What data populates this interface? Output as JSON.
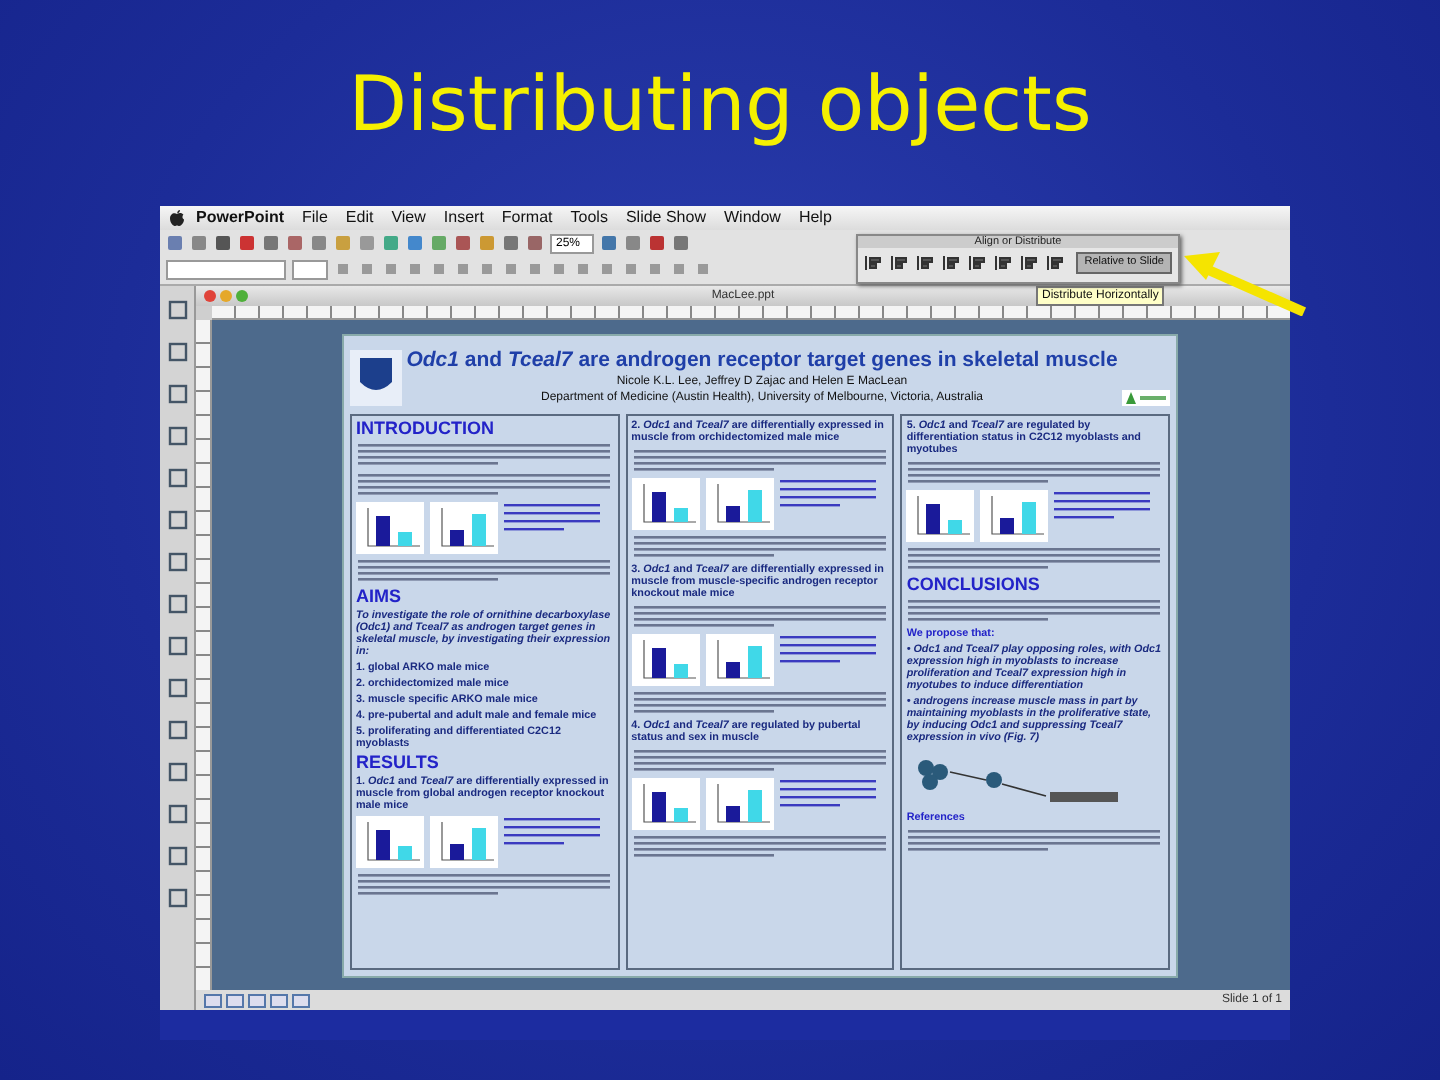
{
  "slide_title": "Distributing objects",
  "menu_bar": {
    "items": [
      "PowerPoint",
      "File",
      "Edit",
      "View",
      "Insert",
      "Format",
      "Tools",
      "Slide Show",
      "Window",
      "Help"
    ]
  },
  "toolbar": {
    "zoom": "25%"
  },
  "align_palette": {
    "title": "Align or Distribute",
    "button": "Relative to Slide",
    "tooltip": "Distribute Horizontally"
  },
  "document": {
    "title": "MacLee.ppt",
    "status": "Slide 1 of 1"
  },
  "poster": {
    "title": "*Odc1* and *Tceal7* are androgen receptor target genes in skeletal muscle",
    "authors": "Nicole K.L. Lee, Jeffrey D Zajac and Helen E MacLean",
    "affiliation": "Department of Medicine (Austin Health), University of Melbourne, Victoria, Australia",
    "columns": [
      [
        {
          "kind": "heading",
          "text": "INTRODUCTION"
        },
        {
          "kind": "filler"
        },
        {
          "kind": "filler"
        },
        {
          "kind": "figure"
        },
        {
          "kind": "filler"
        },
        {
          "kind": "heading",
          "text": "AIMS"
        },
        {
          "kind": "lead",
          "text": "To investigate the role of ornithine decarboxylase (Odc1) and Tceal7 as androgen target genes in skeletal muscle, by investigating their expression in:"
        },
        {
          "kind": "list",
          "items": [
            "1. global ARKO male mice",
            "2. orchidectomized male mice",
            "3. muscle specific ARKO male mice",
            "4. pre-pubertal and adult male and female mice",
            "5. proliferating and differentiated C2C12 myoblasts"
          ]
        },
        {
          "kind": "heading",
          "text": "RESULTS"
        },
        {
          "kind": "subheading",
          "text": "1. *Odc1* and *Tceal7* are differentially expressed in muscle from global androgen receptor knockout male mice"
        },
        {
          "kind": "figure"
        },
        {
          "kind": "filler"
        }
      ],
      [
        {
          "kind": "subheading",
          "text": "2. *Odc1* and *Tceal7* are differentially expressed in muscle from orchidectomized male mice"
        },
        {
          "kind": "filler"
        },
        {
          "kind": "figure"
        },
        {
          "kind": "filler"
        },
        {
          "kind": "subheading",
          "text": "3. *Odc1* and *Tceal7* are differentially expressed in muscle from muscle-specific androgen receptor knockout male mice"
        },
        {
          "kind": "filler"
        },
        {
          "kind": "figure"
        },
        {
          "kind": "filler"
        },
        {
          "kind": "subheading",
          "text": "4. *Odc1* and *Tceal7* are regulated by pubertal status and sex in muscle"
        },
        {
          "kind": "filler"
        },
        {
          "kind": "figure"
        },
        {
          "kind": "filler"
        }
      ],
      [
        {
          "kind": "subheading",
          "text": "5. *Odc1* and *Tceal7* are regulated by differentiation status in C2C12 myoblasts and myotubes"
        },
        {
          "kind": "filler"
        },
        {
          "kind": "figure"
        },
        {
          "kind": "filler"
        },
        {
          "kind": "heading",
          "text": "CONCLUSIONS"
        },
        {
          "kind": "filler"
        },
        {
          "kind": "note",
          "text": "We propose that:"
        },
        {
          "kind": "lead",
          "text": "• Odc1 and Tceal7 play opposing roles, with Odc1 expression high in myoblasts to increase proliferation and Tceal7 expression high in myotubes to induce differentiation"
        },
        {
          "kind": "lead",
          "text": "• androgens increase muscle mass in part by maintaining myoblasts in the proliferative state, by inducing Odc1 and suppressing Tceal7 expression in vivo (Fig. 7)"
        },
        {
          "kind": "diagram"
        },
        {
          "kind": "note",
          "text": "References"
        },
        {
          "kind": "filler"
        }
      ]
    ]
  }
}
